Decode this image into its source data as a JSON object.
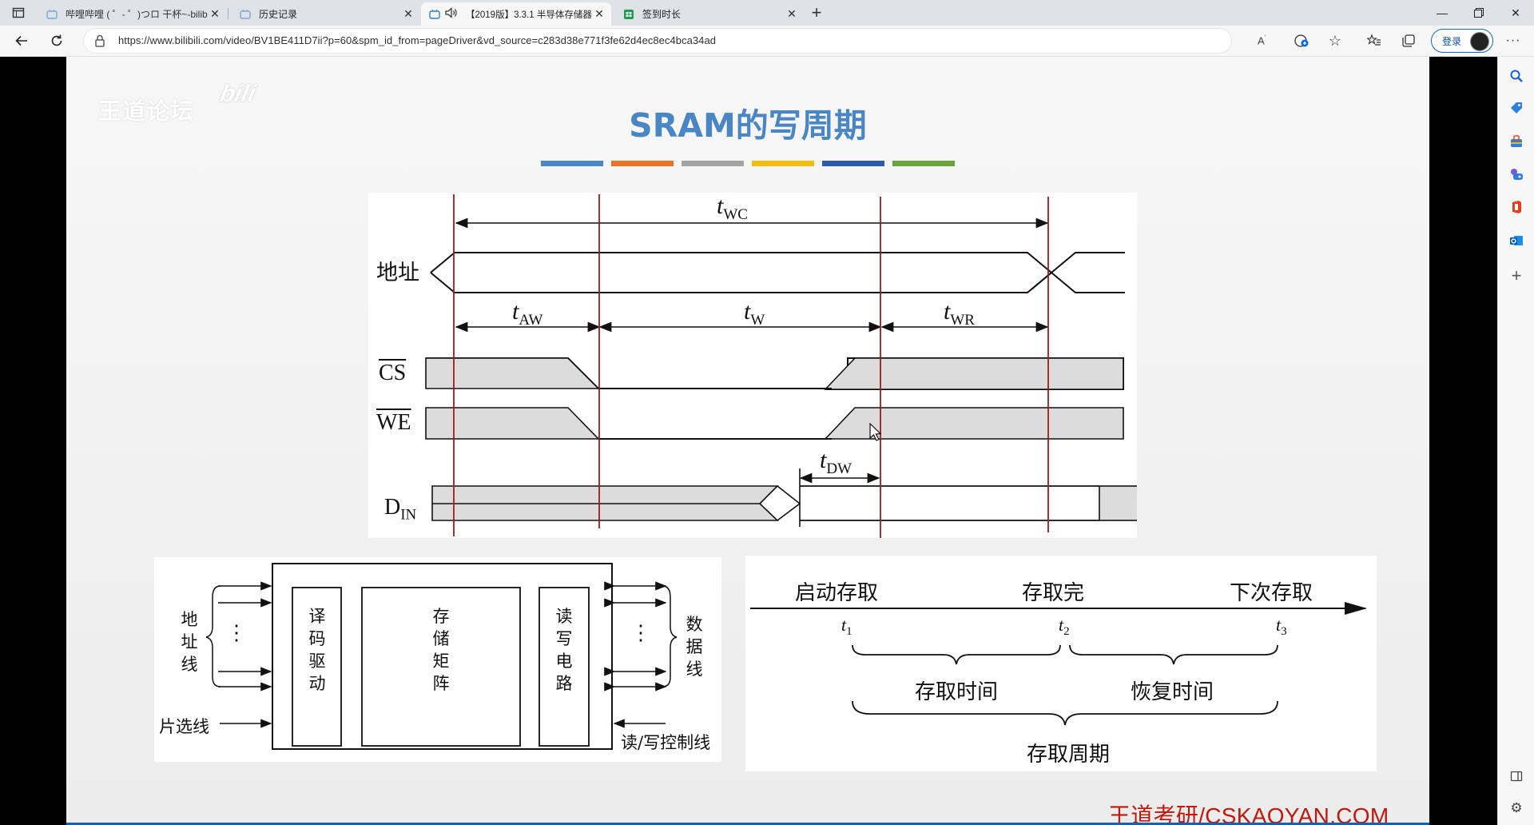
{
  "browser": {
    "tabs": [
      {
        "title": "哔哩哔哩 ( ゜- ゜)つロ 干杯~-bilibili",
        "icon": "bilibili-icon"
      },
      {
        "title": "历史记录",
        "icon": "bilibili-icon"
      },
      {
        "title": "【2019版】3.3.1 半导体存储器",
        "icon": "bilibili-icon"
      },
      {
        "title": "签到时长",
        "icon": "sheet-icon"
      }
    ],
    "url": "https://www.bilibili.com/video/BV1BE411D7ii?p=60&spm_id_from=pageDriver&vd_source=c283d38e771f3fe62d4ec8ec4bca34ad",
    "login_label": "登录"
  },
  "slide": {
    "watermark": "王道论坛",
    "title": "SRAM的写周期",
    "color_bars": [
      "#4a86c8",
      "#e8742a",
      "#a3a3a3",
      "#f2bb10",
      "#2c5bab",
      "#6aa43e"
    ],
    "footer": "王道考研/CSKAOYAN.COM"
  },
  "timing": {
    "signals": {
      "address": "地址",
      "cs": "CS",
      "we": "WE",
      "din_main": "D",
      "din_sub": "IN"
    },
    "intervals": [
      {
        "t": "t",
        "sub": "WC"
      },
      {
        "t": "t",
        "sub": "AW"
      },
      {
        "t": "t",
        "sub": "W"
      },
      {
        "t": "t",
        "sub": "WR"
      },
      {
        "t": "t",
        "sub": "DW"
      }
    ]
  },
  "block": {
    "addr_label": [
      "地",
      "址",
      "线"
    ],
    "data_label": [
      "数",
      "据",
      "线"
    ],
    "cs_label": "片选线",
    "rw_label": "读/写控制线",
    "decoder": [
      "译",
      "码",
      "驱",
      "动"
    ],
    "matrix": [
      "存",
      "储",
      "矩",
      "阵"
    ],
    "rw_circuit": [
      "读",
      "写",
      "电",
      "路"
    ],
    "dots": "⋮"
  },
  "cycle": {
    "events": [
      "启动存取",
      "存取完",
      "下次存取"
    ],
    "ticks": [
      {
        "t": "t",
        "sub": "1"
      },
      {
        "t": "t",
        "sub": "2"
      },
      {
        "t": "t",
        "sub": "3"
      }
    ],
    "access_time": "存取时间",
    "recovery_time": "恢复时间",
    "cycle_time": "存取周期"
  }
}
